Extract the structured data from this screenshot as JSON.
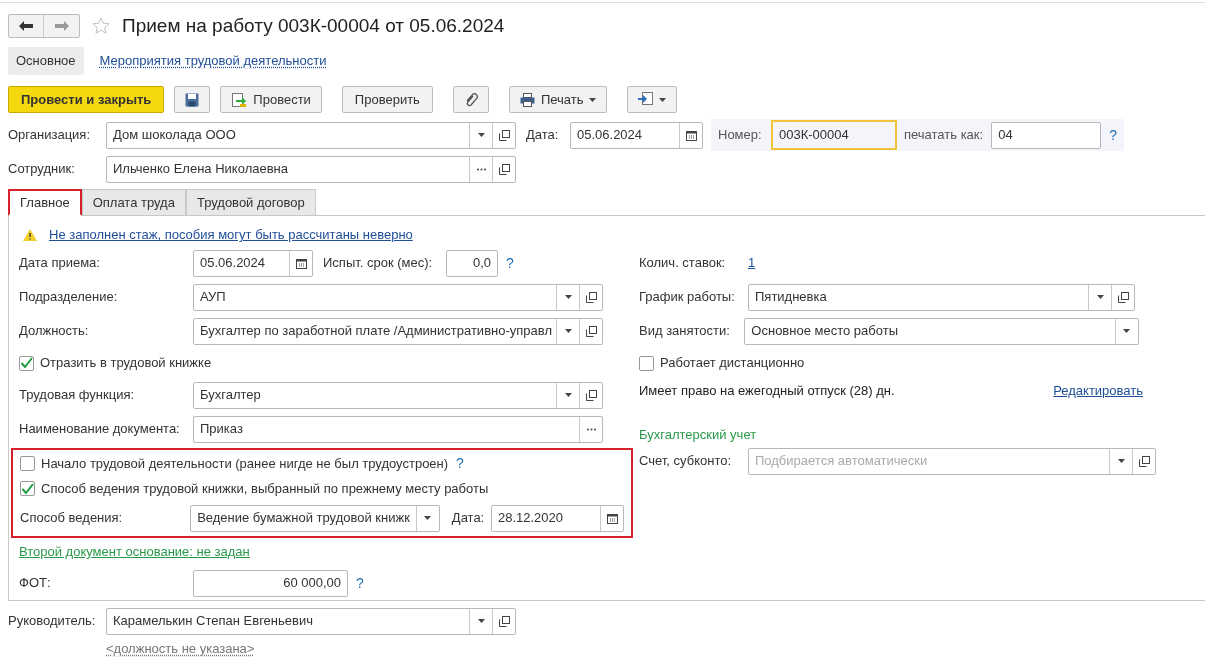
{
  "document": {
    "title": "Прием на работу 003К-00004 от 05.06.2024",
    "favorite": false
  },
  "sections": [
    {
      "label": "Основное",
      "selected": true
    },
    {
      "label": "Мероприятия трудовой деятельности",
      "selected": false
    }
  ],
  "toolbar": [
    {
      "kind": "primary",
      "label": "Провести и закрыть"
    },
    {
      "kind": "save"
    },
    {
      "kind": "post",
      "label": "Провести"
    },
    {
      "kind": "text",
      "label": "Проверить"
    },
    {
      "kind": "attach"
    },
    {
      "kind": "print",
      "label": "Печать"
    },
    {
      "kind": "export"
    }
  ],
  "header": {
    "organization": {
      "kind": "select",
      "label": "Организация:",
      "value": "Дом шоколада ООО"
    },
    "date": {
      "label": "Дата:",
      "value": "05.06.2024"
    },
    "number": {
      "label": "Номер:",
      "value": "003К-00004",
      "focused": true
    },
    "print_as": {
      "label": "печатать как:",
      "value": "04",
      "help": "?"
    },
    "employee": {
      "kind": "choice",
      "label": "Сотрудник:",
      "value": "Ильченко Елена Николаевна"
    }
  },
  "tabs": [
    {
      "label": "Главное",
      "selected": true,
      "highlighted": true
    },
    {
      "label": "Оплата труда",
      "selected": false,
      "highlighted": false
    },
    {
      "label": "Трудовой договор",
      "selected": false,
      "highlighted": false
    }
  ],
  "warning": "Не заполнен стаж, пособия могут быть рассчитаны неверно",
  "left": {
    "hire_date": {
      "label": "Дата приема:",
      "value": "05.06.2024"
    },
    "probation": {
      "label": "Испыт. срок (мес):",
      "value": "0,0",
      "help": "?"
    },
    "rows": [
      {
        "kind": "select",
        "label": "Подразделение:",
        "value": "АУП"
      },
      {
        "kind": "select",
        "label": "Должность:",
        "value": "Бухгалтер по заработной плате /Административно-управл"
      },
      {
        "kind": "checkbox",
        "label": "Отразить в трудовой книжке",
        "checked": true
      },
      {
        "kind": "select",
        "label": "Трудовая функция:",
        "value": "Бухгалтер"
      },
      {
        "kind": "choice",
        "label": "Наименование документа:",
        "value": "Приказ"
      }
    ],
    "group": {
      "highlighted": true,
      "rows": [
        {
          "kind": "checkbox",
          "label": "Начало трудовой деятельности (ранее нигде не был трудоустроен)",
          "checked": false,
          "help": "?"
        },
        {
          "kind": "checkbox",
          "label": "Способ ведения трудовой книжки, выбранный по прежнему месту работы",
          "checked": true
        }
      ],
      "method": {
        "label": "Способ ведения:",
        "value": "Ведение бумажной трудовой книжк"
      },
      "date": {
        "label": "Дата:",
        "value": "28.12.2020"
      }
    },
    "second_document": "Второй документ основание: не задан",
    "fot": {
      "label": "ФОТ:",
      "value": "60 000,00",
      "help": "?"
    }
  },
  "right": {
    "rate": {
      "label": "Колич. ставок:",
      "value": "1"
    },
    "rows": [
      {
        "kind": "select",
        "label": "График работы:",
        "value": "Пятидневка"
      },
      {
        "kind": "dropdown",
        "label": "Вид занятости:",
        "value": "Основное место работы"
      },
      {
        "kind": "checkbox",
        "label": "Работает дистанционно",
        "checked": false
      }
    ],
    "vacation": "Имеет право на ежегодный отпуск (28) дн.",
    "edit_link": "Редактировать",
    "accounting": {
      "title": "Бухгалтерский учет",
      "label": "Счет, субконто:",
      "placeholder": "Подбирается автоматически"
    }
  },
  "footer": {
    "manager": {
      "kind": "select",
      "label": "Руководитель:",
      "value": "Карамелькин Степан Евгеньевич"
    },
    "position_link": "<должность не указана>"
  }
}
